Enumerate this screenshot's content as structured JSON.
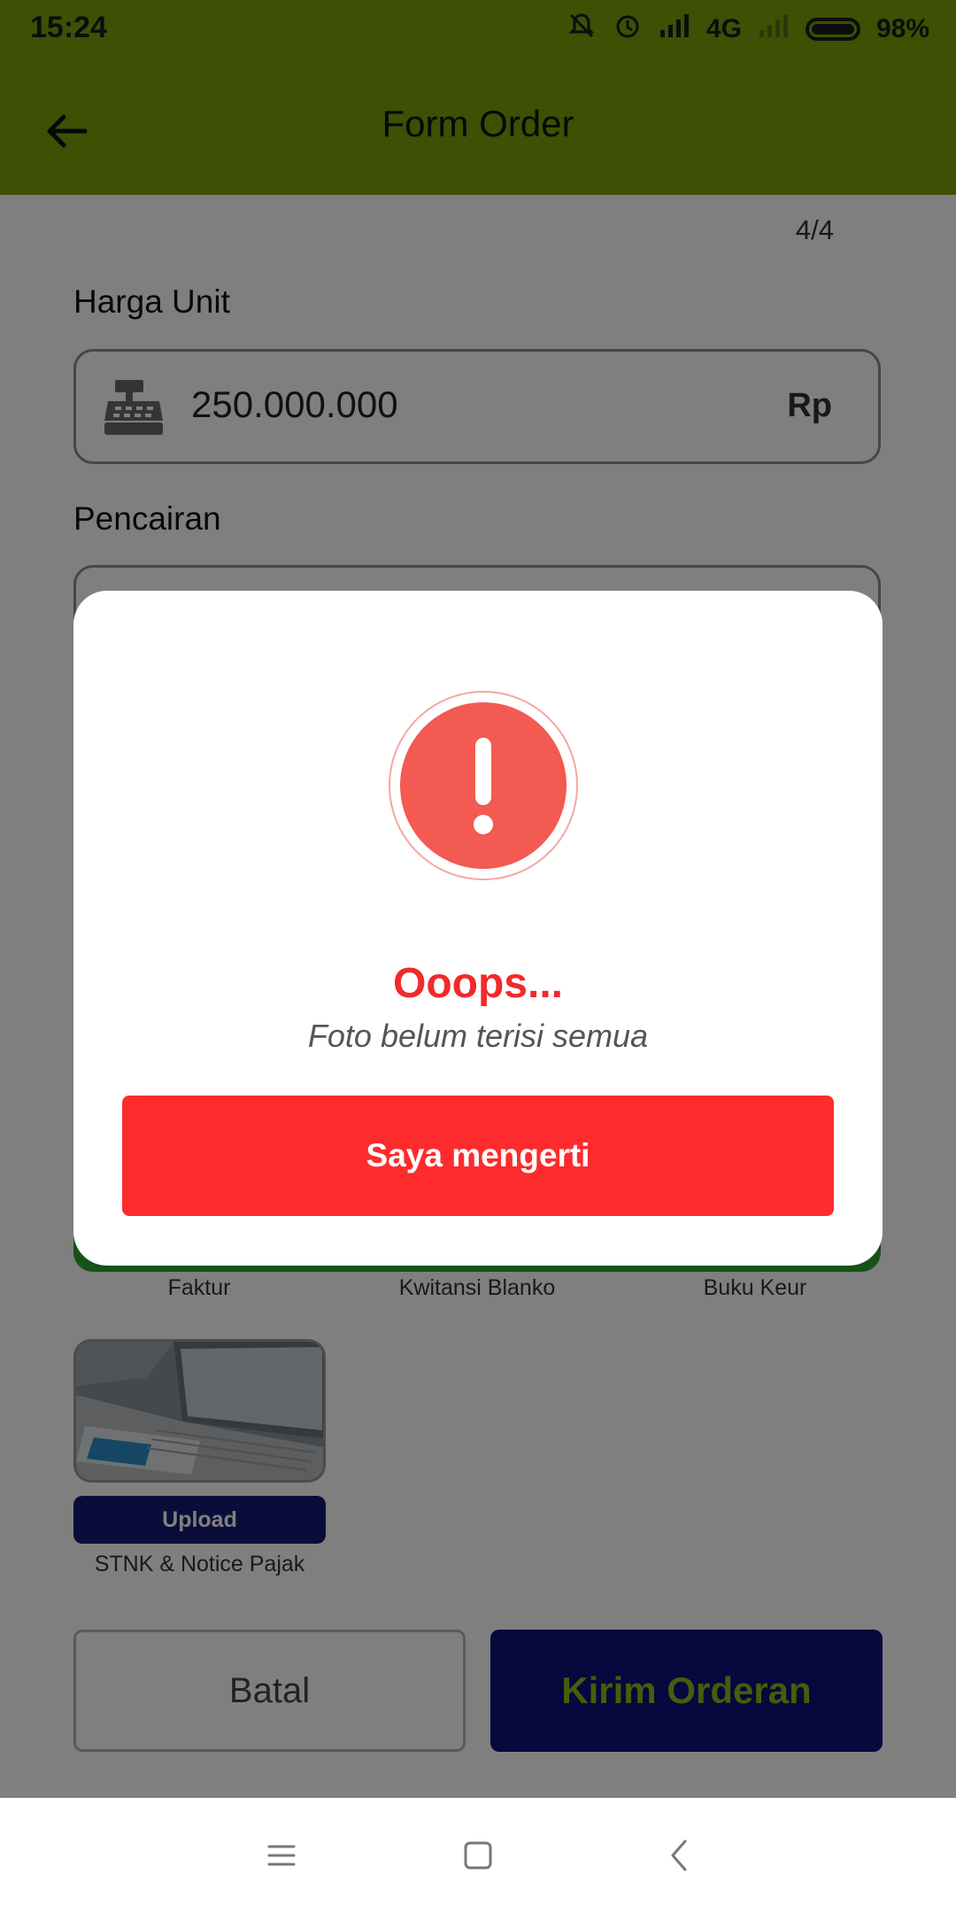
{
  "status_bar": {
    "time": "15:24",
    "network": "4G",
    "battery": "98%"
  },
  "app_bar": {
    "title": "Form Order",
    "back_icon": "arrow-left-icon"
  },
  "form": {
    "step": "4/4",
    "harga_unit": {
      "label": "Harga Unit",
      "value": "250.000.000",
      "suffix": "Rp",
      "icon": "cash-register-icon"
    },
    "pencairan": {
      "label": "Pencairan"
    },
    "documents": [
      {
        "label": "Faktur"
      },
      {
        "label": "Kwitansi Blanko"
      },
      {
        "label": "Buku Keur"
      }
    ],
    "stnk": {
      "upload_label": "Upload",
      "label": "STNK & Notice Pajak"
    },
    "buttons": {
      "cancel": "Batal",
      "submit": "Kirim Orderan"
    }
  },
  "dialog": {
    "icon": "exclamation-icon",
    "title": "Ooops...",
    "message": "Foto belum terisi semua",
    "button": "Saya mengerti"
  },
  "colors": {
    "app_bar": "#7aa107",
    "primary_dark": "#0c117c",
    "accent_green": "#8dbb12",
    "danger": "#fe2b2d",
    "alert_circle": "#f25a52"
  }
}
